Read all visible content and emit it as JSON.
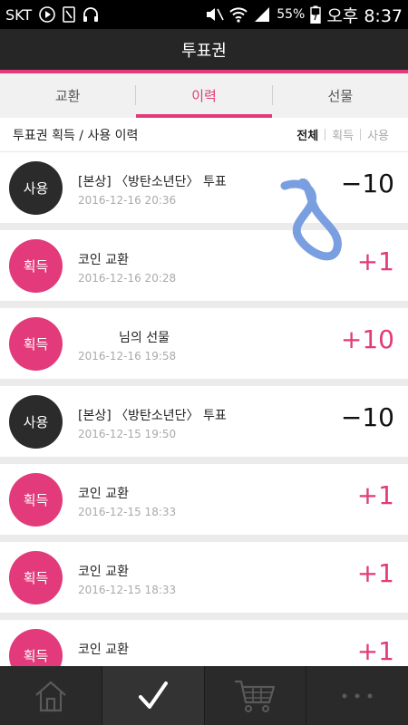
{
  "status_bar": {
    "carrier": "SKT",
    "battery": "55%",
    "time": "오후 8:37"
  },
  "header": {
    "title": "투표권"
  },
  "tabs": [
    {
      "label": "교환",
      "active": false
    },
    {
      "label": "이력",
      "active": true
    },
    {
      "label": "선물",
      "active": false
    }
  ],
  "section": {
    "title": "투표권 획득 / 사용 이력",
    "filters": [
      "전체",
      "획득",
      "사용"
    ],
    "active_filter": "전체"
  },
  "history": [
    {
      "type": "사용",
      "title": "[본상] 〈방탄소년단〉 투표",
      "date": "2016-12-16 20:36",
      "amount": "−10"
    },
    {
      "type": "획득",
      "title": "코인 교환",
      "date": "2016-12-16 20:28",
      "amount": "+1"
    },
    {
      "type": "획득",
      "title": "님의 선물",
      "date": "2016-12-16 19:58",
      "amount": "+10"
    },
    {
      "type": "사용",
      "title": "[본상] 〈방탄소년단〉 투표",
      "date": "2016-12-15 19:50",
      "amount": "−10"
    },
    {
      "type": "획득",
      "title": "코인 교환",
      "date": "2016-12-15 18:33",
      "amount": "+1"
    },
    {
      "type": "획득",
      "title": "코인 교환",
      "date": "2016-12-15 18:33",
      "amount": "+1"
    },
    {
      "type": "획득",
      "title": "코인 교환",
      "date": "",
      "amount": "+1"
    }
  ],
  "bottom_nav": [
    {
      "icon": "home-icon",
      "active": false
    },
    {
      "icon": "check-icon",
      "active": true
    },
    {
      "icon": "cart-icon",
      "active": false
    },
    {
      "icon": "more-icon",
      "active": false
    }
  ],
  "colors": {
    "accent": "#e23a7a",
    "dark_badge": "#2b2b2b",
    "header_bg": "#262626",
    "scribble": "#7a9fe0"
  }
}
